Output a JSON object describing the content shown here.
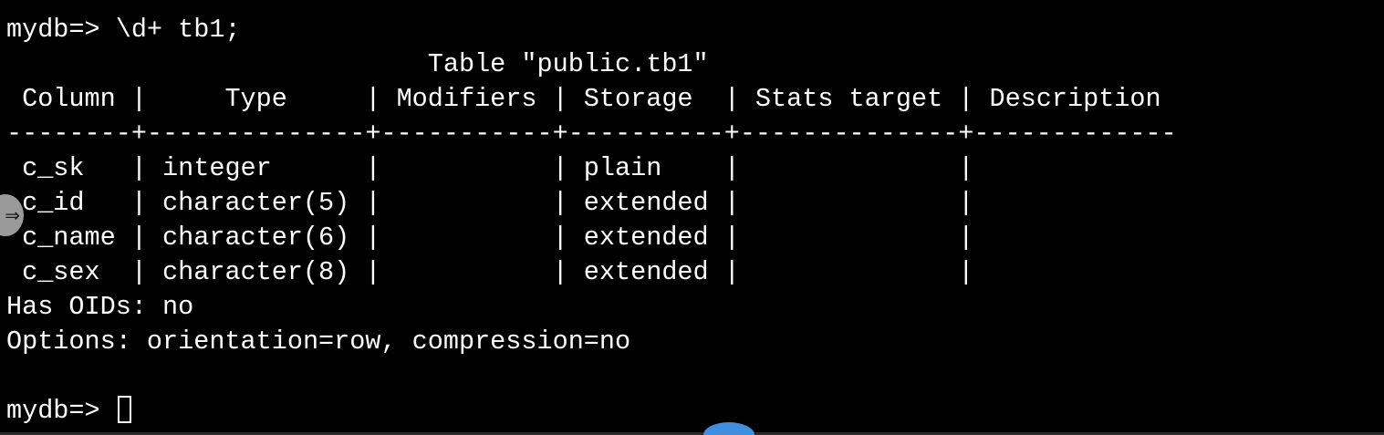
{
  "terminal": {
    "lines": [
      "mydb=> \\d+ tb1;",
      "                           Table \"public.tb1\"",
      " Column |     Type     | Modifiers | Storage  | Stats target | Description",
      "--------+--------------+-----------+----------+--------------+-------------",
      " c_sk   | integer      |           | plain    |              |",
      " c_id   | character(5) |           | extended |              |",
      " c_name | character(6) |           | extended |              |",
      " c_sex  | character(8) |           | extended |              |",
      "Has OIDs: no",
      "Options: orientation=row, compression=no",
      ""
    ],
    "prompt": "mydb=> "
  },
  "handle": {
    "icon": "double-arrow-right-icon",
    "glyph": "⇒"
  },
  "colors": {
    "background": "#000000",
    "text": "#ffffff",
    "handle": "#9a9a9a",
    "scroll_indicator": "#3d8fe0"
  }
}
